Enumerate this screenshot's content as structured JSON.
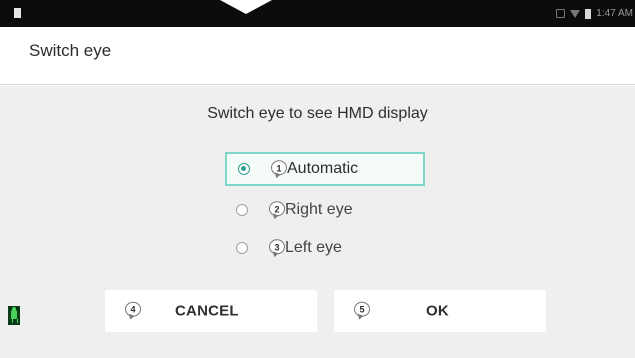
{
  "status_bar": {
    "time": "1:47 AM",
    "icons": [
      "notification-icon",
      "signal-icon",
      "wifi-icon",
      "battery-icon"
    ]
  },
  "title_bar": {
    "title": "Switch eye"
  },
  "dialog": {
    "message": "Switch eye to see HMD display",
    "options": [
      {
        "number": "1",
        "label": "Automatic",
        "selected": true
      },
      {
        "number": "2",
        "label": "Right eye",
        "selected": false
      },
      {
        "number": "3",
        "label": "Left eye",
        "selected": false
      }
    ],
    "buttons": {
      "cancel": {
        "number": "4",
        "label": "CANCEL"
      },
      "ok": {
        "number": "5",
        "label": "OK"
      }
    }
  },
  "colors": {
    "accent": "#2aa192",
    "selection_border": "#7fd6c8",
    "dialog_background": "#efefef",
    "status_bar": "#0b0b0b"
  },
  "side_icon": "android-icon"
}
